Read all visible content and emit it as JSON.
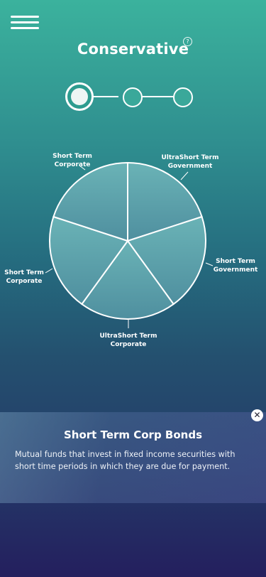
{
  "header": {
    "menu_icon": "hamburger-menu-icon",
    "title": "Conservative",
    "help_icon": "question-circle-icon",
    "help_glyph": "?"
  },
  "stepper": {
    "total_steps": 3,
    "current_step": 1
  },
  "chart_data": {
    "type": "pie",
    "slices": [
      {
        "label_line1": "UltraShort Term",
        "label_line2": "Government",
        "value": 20
      },
      {
        "label_line1": "Short Term",
        "label_line2": "Government",
        "value": 20
      },
      {
        "label_line1": "UltraShort Term",
        "label_line2": "Corporate",
        "value": 20
      },
      {
        "label_line1": "Short Term",
        "label_line2": "Corporate",
        "value": 20
      },
      {
        "label_line1": "Short Term",
        "label_line2": "Corporate",
        "value": 20
      }
    ],
    "slice_color": "#5fa8ad",
    "stroke_color": "#ffffff"
  },
  "info_card": {
    "title": "Short Term Corp Bonds",
    "description": "Mutual funds that invest in fixed income securities with short time periods in which they are due for payment.",
    "close_icon": "close-x-icon",
    "close_glyph": "✕"
  }
}
